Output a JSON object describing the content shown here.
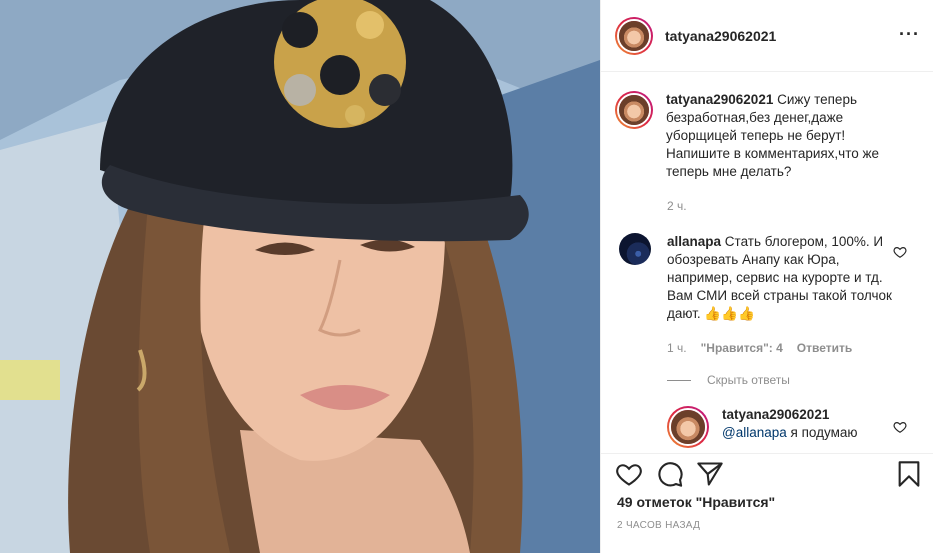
{
  "post": {
    "author": "tatyana29062021",
    "caption": {
      "author": "tatyana29062021",
      "text": "Сижу теперь безработная,без денег,даже уборщицей теперь не берут! Напишите в комментариях,что же теперь мне делать?",
      "time": "2 ч."
    },
    "comment": {
      "author": "allanapa",
      "text": "Стать блогером, 100%. И обозревать Анапу как Юра, например, сервис на курорте и тд. Вам СМИ всей страны такой толчок дают. 👍👍👍",
      "time": "1 ч.",
      "likes": "\"Нравится\": 4",
      "reply_label": "Ответить",
      "hide_replies": "Скрыть ответы"
    },
    "reply": {
      "author": "tatyana29062021",
      "mention": "@allanapa",
      "text": "я подумаю"
    },
    "likes_count": "49 отметок \"Нравится\"",
    "timestamp": "2 часов назад"
  },
  "icons": {
    "more": "more-icon",
    "like": "heart-icon",
    "comment": "comment-icon",
    "share": "share-icon",
    "save": "bookmark-icon"
  }
}
